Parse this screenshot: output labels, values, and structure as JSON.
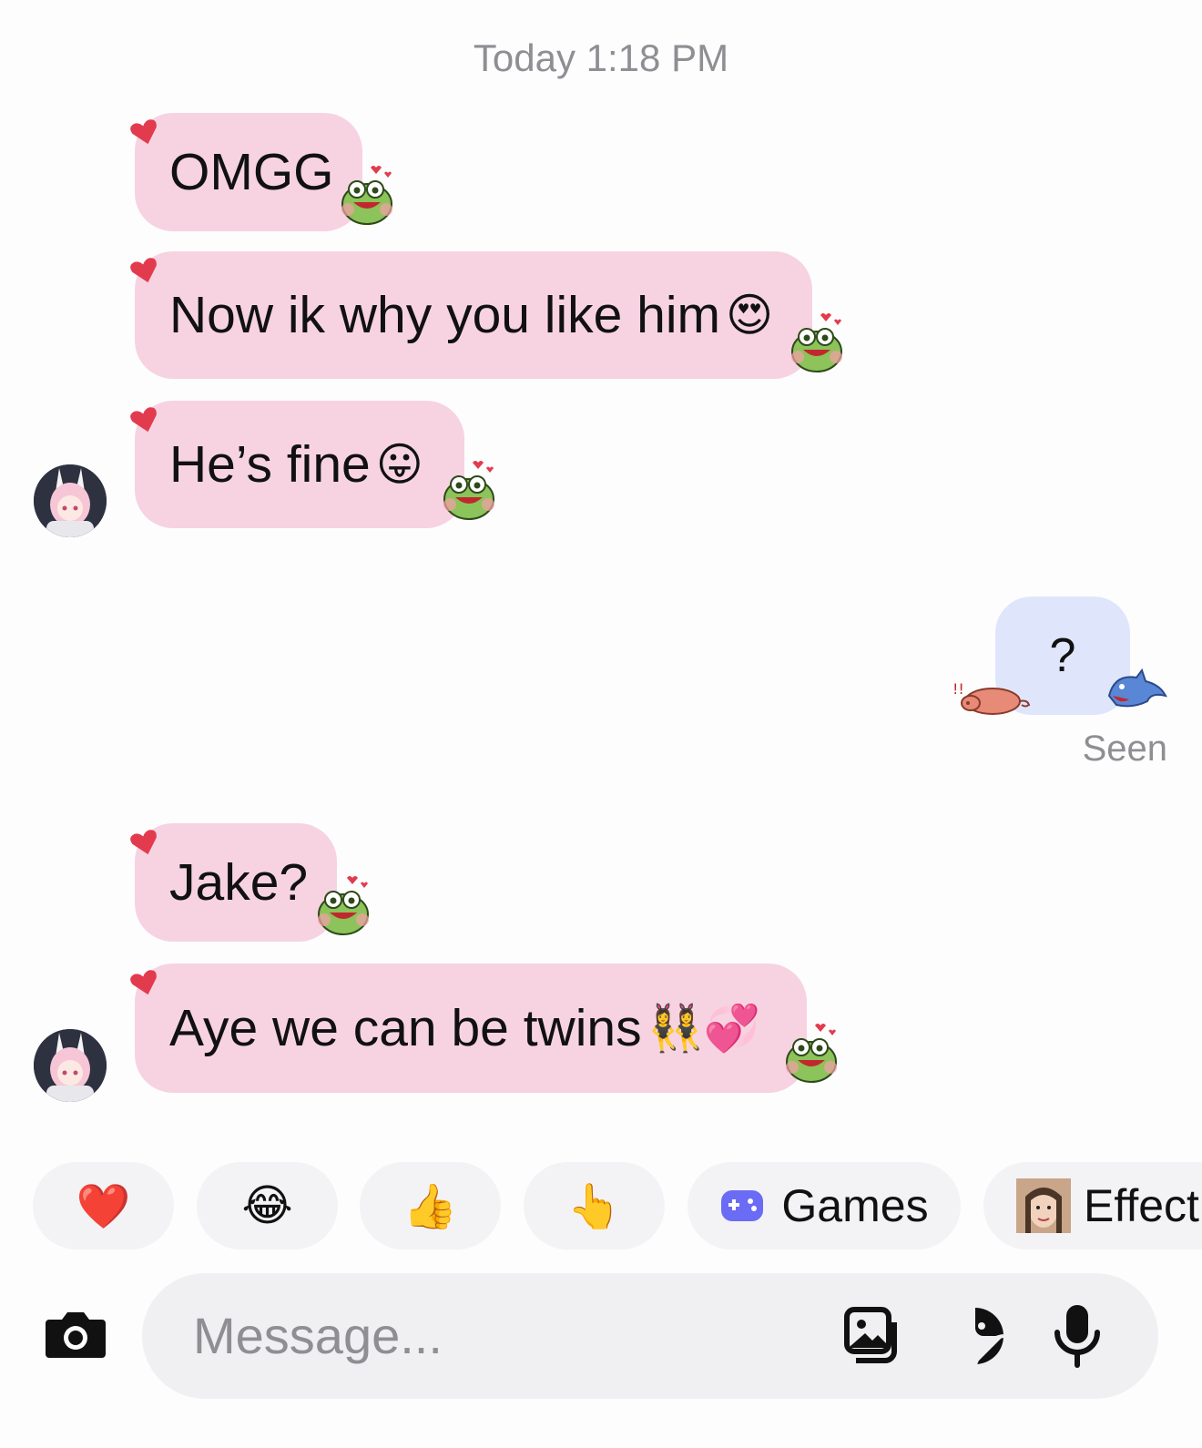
{
  "timestamp": "Today 1:18 PM",
  "messages": [
    {
      "text": "OMGG",
      "emoji": ""
    },
    {
      "text": "Now ik why you like him",
      "emoji": "😍"
    },
    {
      "text": "He’s fine",
      "emoji": "😛"
    },
    {
      "text": "Jake?",
      "emoji": ""
    },
    {
      "text": "Aye we can be twins ",
      "emoji": "👯‍♀️💞"
    }
  ],
  "sent": {
    "text": "?",
    "status": "Seen"
  },
  "quick_reactions": [
    {
      "glyph": "❤️",
      "icon": "heart-icon"
    },
    {
      "glyph": "😂",
      "icon": "laughing-emoji-icon"
    },
    {
      "glyph": "👍",
      "icon": "thumbs-up-icon"
    },
    {
      "glyph": "👆",
      "icon": "pointing-hand-icon"
    }
  ],
  "games": {
    "label": "Games",
    "icon": "gamepad-icon"
  },
  "effects": {
    "label": "Effect",
    "icon": "effects-thumbnail"
  },
  "composer": {
    "placeholder": "Message..."
  },
  "colors": {
    "received_bubble": "#f7d3e1",
    "sent_bubble": "#dfe6fb",
    "heart": "#e23b4e",
    "frog": "#7fb84a",
    "games_icon": "#6a6cf5"
  },
  "icons": [
    "camera-icon",
    "gallery-icon",
    "sticker-icon",
    "microphone-icon"
  ]
}
